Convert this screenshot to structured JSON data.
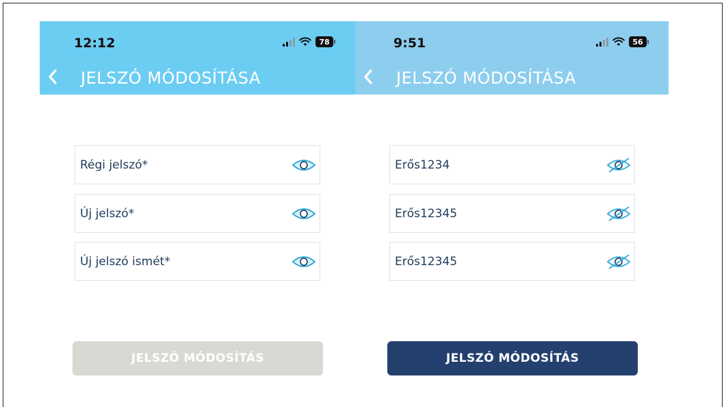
{
  "colors": {
    "header_left": "#6ccdf3",
    "header_right": "#8dcdee",
    "field_text": "#1f3a5a",
    "eye": "#2fa8dd",
    "button_disabled": "#dad8d3",
    "button_active": "#24406e"
  },
  "screens": [
    {
      "status": {
        "time": "12:12",
        "battery": "78"
      },
      "header": {
        "title": "JELSZÓ MÓDOSÍTÁSA",
        "back_icon": "chevron-left-icon"
      },
      "fields": [
        {
          "label": "Régi jelszó*",
          "icon": "eye-icon"
        },
        {
          "label": "Új jelszó*",
          "icon": "eye-icon"
        },
        {
          "label": "Új jelszó ismét*",
          "icon": "eye-icon"
        }
      ],
      "button": {
        "label": "JELSZÓ MÓDOSÍTÁS",
        "state": "disabled"
      }
    },
    {
      "status": {
        "time": "9:51",
        "battery": "56"
      },
      "header": {
        "title": "JELSZÓ MÓDOSÍTÁSA",
        "back_icon": "chevron-left-icon"
      },
      "fields": [
        {
          "value": "Erős1234",
          "icon": "eye-off-icon"
        },
        {
          "value": "Erős12345",
          "icon": "eye-off-icon"
        },
        {
          "value": "Erős12345",
          "icon": "eye-off-icon"
        }
      ],
      "button": {
        "label": "JELSZÓ MÓDOSÍTÁS",
        "state": "enabled"
      }
    }
  ]
}
